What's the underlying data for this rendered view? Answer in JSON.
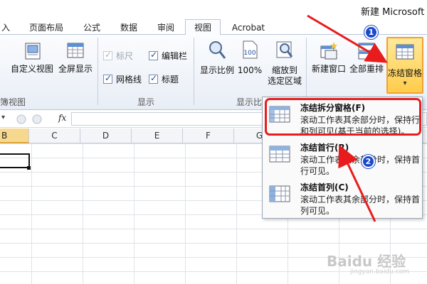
{
  "window": {
    "title": "新建 Microsoft E"
  },
  "tabs": [
    {
      "label": "入"
    },
    {
      "label": "页面布局"
    },
    {
      "label": "公式"
    },
    {
      "label": "数据"
    },
    {
      "label": "审阅"
    },
    {
      "label": "视图",
      "active": true
    },
    {
      "label": "Acrobat"
    }
  ],
  "ribbon": {
    "workbook_views": {
      "label": "簿视图",
      "buttons": [
        {
          "label": "自定义视图",
          "icon": "custom-view-icon"
        },
        {
          "label": "全屏显示",
          "icon": "full-screen-icon"
        }
      ]
    },
    "show": {
      "label": "显示",
      "checkboxes": [
        {
          "label": "标尺",
          "checked": true,
          "disabled": true
        },
        {
          "label": "编辑栏",
          "checked": true,
          "disabled": false
        },
        {
          "label": "网格线",
          "checked": true,
          "disabled": false
        },
        {
          "label": "标题",
          "checked": true,
          "disabled": false
        }
      ]
    },
    "zoom": {
      "label": "显示比",
      "buttons": [
        {
          "label": "显示比例",
          "icon": "zoom-icon"
        },
        {
          "label": "100%",
          "icon": "zoom-100-icon"
        },
        {
          "label_line1": "缩放到",
          "label_line2": "选定区域",
          "icon": "zoom-selection-icon"
        }
      ]
    },
    "window": {
      "buttons": [
        {
          "label": "新建窗口",
          "icon": "new-window-icon"
        },
        {
          "label": "全部重排",
          "icon": "arrange-all-icon"
        },
        {
          "label": "冻结窗格",
          "icon": "freeze-panes-icon",
          "dropdown_arrow": "▾"
        }
      ]
    }
  },
  "formula_bar": {
    "name_box_arrow": "▾",
    "fx": "fx",
    "value": ""
  },
  "sheet": {
    "columns": [
      "B",
      "C",
      "D",
      "E",
      "F",
      "G"
    ],
    "selected_column": "B"
  },
  "freeze_menu": {
    "items": [
      {
        "title": "冻结拆分窗格(F)",
        "desc": "滚动工作表其余部分时，保持行和列可见(基于当前的选择)。",
        "icon": "freeze-split-icon"
      },
      {
        "title": "冻结首行(R)",
        "desc": "滚动工作表其余部分时，保持首行可见。",
        "icon": "freeze-top-row-icon"
      },
      {
        "title": "冻结首列(C)",
        "desc": "滚动工作表其余部分时，保持首列可见。",
        "icon": "freeze-first-column-icon"
      }
    ]
  },
  "annotations": {
    "badges": [
      "1",
      "2"
    ],
    "highlight_color": "#e81c1c",
    "badge_color": "#1a49c9"
  },
  "watermark": {
    "text": "Baidu 经验",
    "sub": "jingyan.baidu.com"
  }
}
